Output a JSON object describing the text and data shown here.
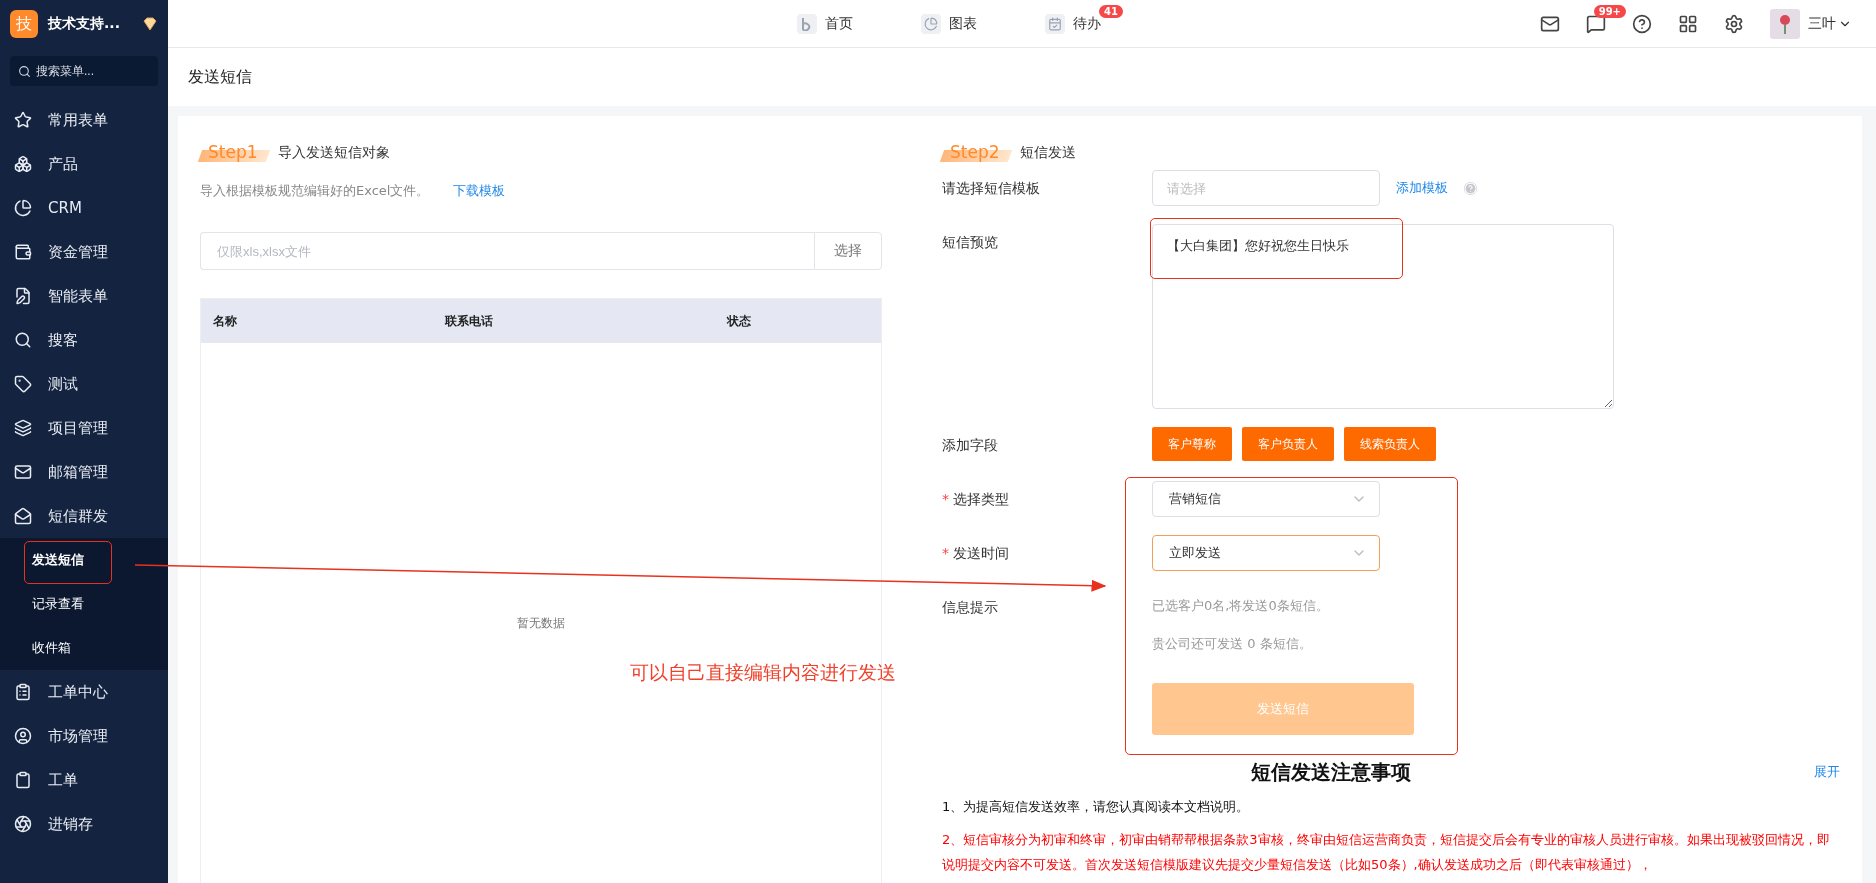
{
  "sidebar": {
    "logo": "技",
    "org_name": "技术支持...",
    "search": {
      "placeholder": "搜索菜单..."
    },
    "items": [
      {
        "label": "常用表单"
      },
      {
        "label": "产品"
      },
      {
        "label": "CRM"
      },
      {
        "label": "资金管理"
      },
      {
        "label": "智能表单"
      },
      {
        "label": "搜客"
      },
      {
        "label": "测试"
      },
      {
        "label": "项目管理"
      },
      {
        "label": "邮箱管理"
      },
      {
        "label": "短信群发",
        "children": [
          {
            "label": "发送短信",
            "selected": true
          },
          {
            "label": "记录查看",
            "selected": false
          },
          {
            "label": "收件箱",
            "selected": false
          }
        ]
      },
      {
        "label": "工单中心"
      },
      {
        "label": "市场管理"
      },
      {
        "label": "工单"
      },
      {
        "label": "进销存"
      }
    ]
  },
  "topnav": {
    "tabs": [
      {
        "label": "首页"
      },
      {
        "label": "图表"
      },
      {
        "label": "待办",
        "badge": "41"
      }
    ],
    "message_badge": "99+",
    "user_name": "三叶"
  },
  "page_title": "发送短信",
  "step1": {
    "step": "Step1",
    "title": "导入发送短信对象",
    "description": "导入根据模板规范编辑好的Excel文件。",
    "download_link": "下载模板",
    "file_input": {
      "placeholder": "仅限xls,xlsx文件"
    },
    "choose_button": "选择",
    "table": {
      "columns": [
        "名称",
        "联系电话",
        "状态"
      ],
      "empty_text": "暂无数据"
    }
  },
  "step2": {
    "step": "Step2",
    "title": "短信发送",
    "required_mark": "*",
    "template": {
      "label": "请选择短信模板",
      "placeholder": "请选择",
      "add_link": "添加模板"
    },
    "preview": {
      "label": "短信预览",
      "value": "【大白集团】您好祝您生日快乐"
    },
    "fields": {
      "label": "添加字段",
      "buttons": [
        "客户尊称",
        "客户负责人",
        "线索负责人"
      ]
    },
    "type": {
      "label": "选择类型",
      "required": true,
      "value": "营销短信",
      "focused": false
    },
    "time": {
      "label": "发送时间",
      "required": true,
      "value": "立即发送",
      "focused": true
    },
    "info": {
      "label": "信息提示",
      "lines": [
        "已选客户0名,将发送0条短信。",
        "贵公司还可发送 0 条短信。"
      ]
    },
    "send_button": {
      "label": "发送短信",
      "disabled": true
    }
  },
  "notice": {
    "title": "短信发送注意事项",
    "expand_link": "展开",
    "lines": [
      {
        "text": "1、为提高短信发送效率，请您认真阅读本文档说明。",
        "kind": "normal"
      },
      {
        "text": "2、短信审核分为初审和终审，初审由销帮帮根据条款3审核，终审由短信运营商负责，短信提交后会有专业的审核人员进行审核。如果出现被驳回情况，即说明提交内容不可发送。首次发送短信模版建议先提交少量短信发送（比如50条）,确认发送成功之后（即代表审核通过），",
        "kind": "warning"
      }
    ]
  },
  "annotation": {
    "text": "可以自己直接编辑内容进行发送"
  }
}
